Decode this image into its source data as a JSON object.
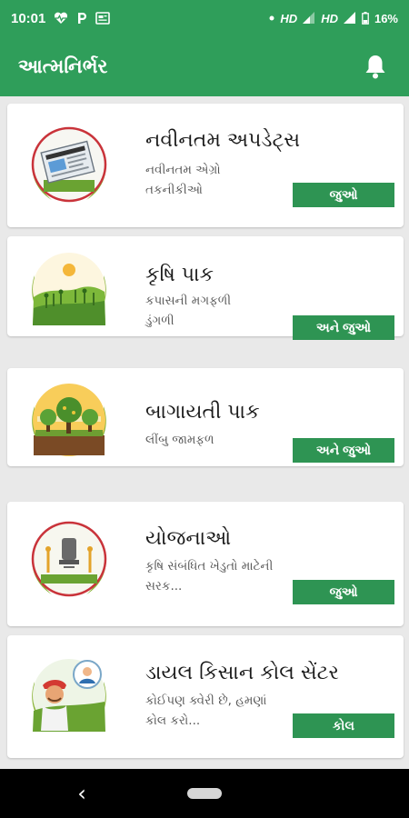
{
  "status_bar": {
    "time": "10:01",
    "network_1": "HD",
    "network_2": "HD",
    "battery": "16%",
    "icons": [
      "heart-monitor-icon",
      "p-icon",
      "news-icon",
      "dot-icon",
      "wifi-icon",
      "signal-icon",
      "battery-icon"
    ]
  },
  "app_bar": {
    "title": "આત્મનિર્ભર",
    "bell_icon": "bell-icon"
  },
  "cards": [
    {
      "title": "નવીનતમ અપડેટ્સ",
      "desc_line1": "નવીનતમ એગ્રો",
      "desc_line2": "તકનીકીઓ",
      "button": "જુઓ",
      "thumb": "latest-updates-newspaper-image"
    },
    {
      "title": "કૃષિ પાક",
      "desc_line1": "કપાસની મગફળી",
      "desc_line2": "ડુંગળી",
      "button": "અને જુઓ",
      "thumb": "crop-field-image"
    },
    {
      "title": "બાગાયતી પાક",
      "desc_line1": "લીંબુ જામફળ",
      "desc_line2": "",
      "button": "અને જુઓ",
      "thumb": "orchard-trees-image"
    },
    {
      "title": "યોજનાઓ",
      "desc_line1": "કૃષિ સંબંધિત ખેડુતો માટેની",
      "desc_line2": "સરક...",
      "button": "જુઓ",
      "thumb": "government-emblem-image"
    },
    {
      "title": "ડાયલ કિસાન કોલ સેંટર",
      "desc_line1": "કોઈપણ ક્વેરી છે, હમણાં",
      "desc_line2": "કોલ કરો...",
      "button": "કોલ",
      "thumb": "farmer-call-center-image"
    }
  ],
  "nav_bar": {
    "back_icon": "back-chevron-icon",
    "home_icon": "home-pill-icon"
  },
  "colors": {
    "primary": "#2f9e5a",
    "button": "#2e9453",
    "background": "#e9e9e9"
  }
}
